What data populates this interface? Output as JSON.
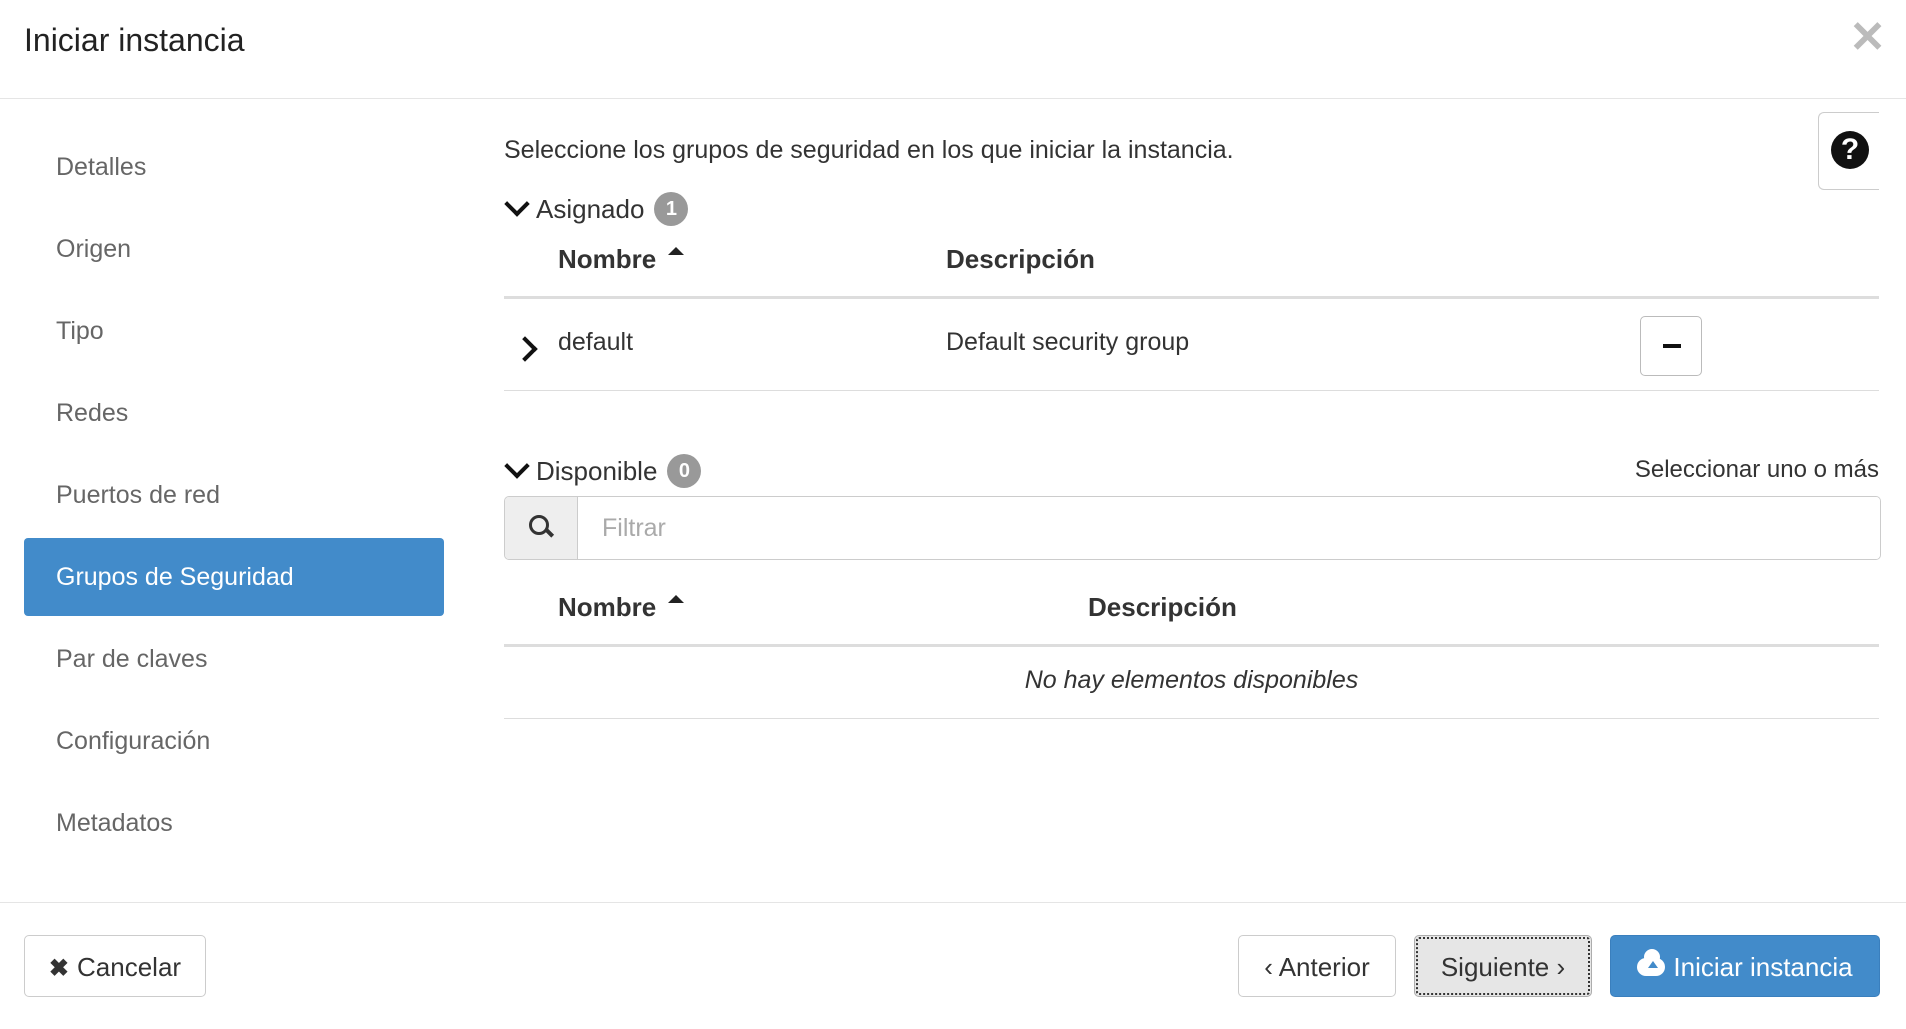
{
  "header": {
    "title": "Iniciar instancia",
    "close_icon": "close-icon"
  },
  "nav": {
    "items": [
      {
        "label": "Detalles",
        "active": false
      },
      {
        "label": "Origen",
        "active": false
      },
      {
        "label": "Tipo",
        "active": false
      },
      {
        "label": "Redes",
        "active": false
      },
      {
        "label": "Puertos de red",
        "active": false
      },
      {
        "label": "Grupos de Seguridad",
        "active": true
      },
      {
        "label": "Par de claves",
        "active": false
      },
      {
        "label": "Configuración",
        "active": false
      },
      {
        "label": "Metadatos",
        "active": false
      }
    ]
  },
  "main": {
    "intro": "Seleccione los grupos de seguridad en los que iniciar la instancia.",
    "help_icon": "question-circle-icon",
    "assigned": {
      "label": "Asignado",
      "count": "1",
      "columns": {
        "name": "Nombre",
        "description": "Descripción"
      },
      "rows": [
        {
          "name": "default",
          "description": "Default security group"
        }
      ]
    },
    "available": {
      "label": "Disponible",
      "count": "0",
      "select_hint": "Seleccionar uno o más",
      "filter_placeholder": "Filtrar",
      "columns": {
        "name": "Nombre",
        "description": "Descripción"
      },
      "empty_text": "No hay elementos disponibles"
    }
  },
  "footer": {
    "cancel_label": "Cancelar",
    "back_label": "‹ Anterior",
    "next_label": "Siguiente ›",
    "launch_label": "Iniciar instancia"
  },
  "colors": {
    "accent": "#428bca",
    "badge": "#999999"
  }
}
